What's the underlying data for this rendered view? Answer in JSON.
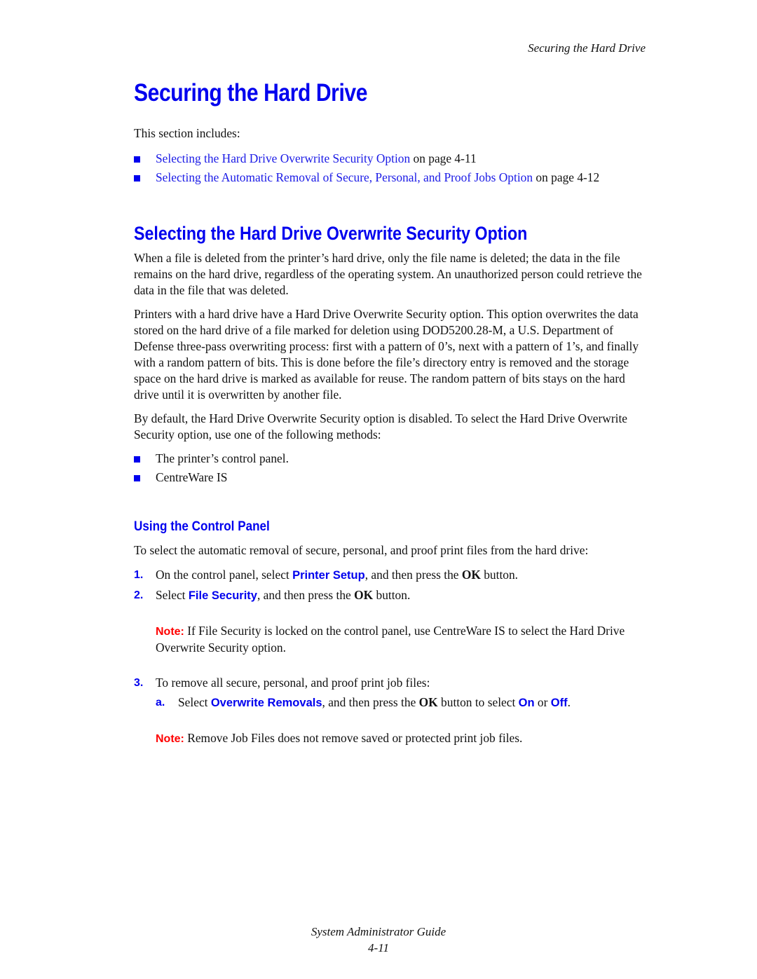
{
  "running_head": "Securing the Hard Drive",
  "title": "Securing the Hard Drive",
  "intro": "This section includes:",
  "toc": [
    {
      "link": "Selecting the Hard Drive Overwrite Security Option",
      "suffix": " on page 4-11"
    },
    {
      "link": "Selecting the Automatic Removal of Secure, Personal, and Proof Jobs Option",
      "suffix": " on page 4-12"
    }
  ],
  "section": {
    "heading": "Selecting the Hard Drive Overwrite Security Option",
    "paragraphs": [
      "When a file is deleted from the printer’s hard drive, only the file name is deleted; the data in the file remains on the hard drive, regardless of the operating system. An unauthorized person could retrieve the data in the file that was deleted.",
      "Printers with a hard drive have a Hard Drive Overwrite Security option. This option overwrites the data stored on the hard drive of a file marked for deletion using DOD5200.28-M, a U.S. Department of Defense three-pass overwriting process: first with a pattern of 0’s, next with a pattern of 1’s, and finally with a random pattern of bits. This is done before the file’s directory entry is removed and the storage space on the hard drive is marked as available for reuse. The random pattern of bits stays on the hard drive until it is overwritten by another file.",
      "By default, the Hard Drive Overwrite Security option is disabled. To select the Hard Drive Overwrite Security option, use one of the following methods:"
    ],
    "methods": [
      "The printer’s control panel.",
      "CentreWare IS"
    ]
  },
  "subsection": {
    "heading": "Using the Control Panel",
    "intro": "To select the automatic removal of secure, personal, and proof print files from the hard drive:",
    "steps": [
      {
        "num": "1.",
        "pre": "On the control panel, select ",
        "ui": "Printer Setup",
        "mid": ", and then press the ",
        "key": "OK",
        "post": " button."
      },
      {
        "num": "2.",
        "pre": "Select ",
        "ui": "File Security",
        "mid": ", and then press the ",
        "key": "OK",
        "post": " button."
      }
    ],
    "note1": {
      "label": "Note:",
      "text": " If File Security is locked on the control panel, use CentreWare IS to select the Hard Drive Overwrite Security option."
    },
    "step3": {
      "num": "3.",
      "text": "To remove all secure, personal, and proof print job files:"
    },
    "step3a": {
      "letter": "a.",
      "pre": "Select ",
      "ui": "Overwrite Removals",
      "mid": ", and then press the ",
      "key": "OK",
      "mid2": " button to select ",
      "on": "On",
      "or": " or ",
      "off": "Off",
      "post": "."
    },
    "note2": {
      "label": "Note:",
      "text": " Remove Job Files does not remove saved or protected print job files."
    }
  },
  "footer": {
    "guide": "System Administrator Guide",
    "page": "4-11"
  },
  "colors": {
    "heading": "#0000ee",
    "link": "#1a1ae6",
    "note": "#ff0000",
    "text": "#111111"
  }
}
